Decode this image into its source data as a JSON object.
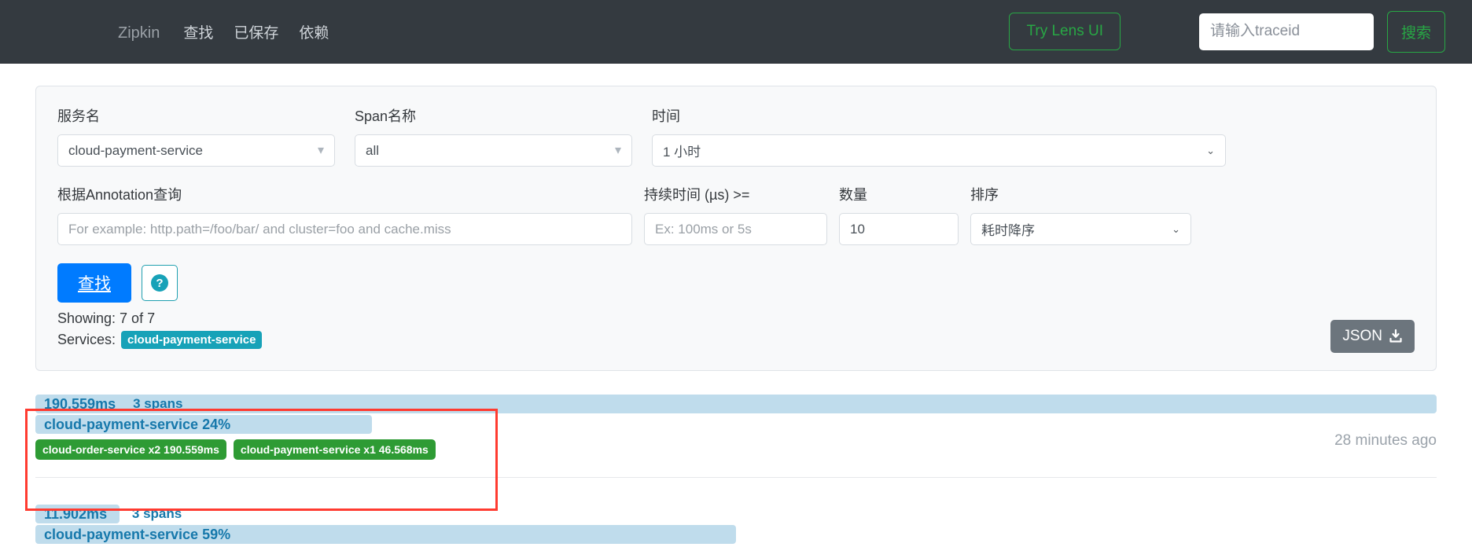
{
  "navbar": {
    "brand": "Zipkin",
    "items": [
      {
        "label": "查找",
        "name": "nav-find"
      },
      {
        "label": "已保存",
        "name": "nav-saved"
      },
      {
        "label": "依赖",
        "name": "nav-dependencies"
      }
    ],
    "lens_button": "Try Lens UI",
    "trace_search_placeholder": "请输入traceid",
    "trace_search_value": "",
    "search_button": "搜索",
    "accent_green": "#28a745",
    "background": "#343a40"
  },
  "search_panel": {
    "service": {
      "label": "服务名",
      "value": "cloud-payment-service"
    },
    "span": {
      "label": "Span名称",
      "value": "all"
    },
    "time": {
      "label": "时间",
      "value": "1 小时"
    },
    "annotation": {
      "label": "根据Annotation查询",
      "placeholder": "For example: http.path=/foo/bar/ and cluster=foo and cache.miss",
      "value": ""
    },
    "duration": {
      "label": "持续时间 (µs) >=",
      "placeholder": "Ex: 100ms or 5s",
      "value": ""
    },
    "limit": {
      "label": "数量",
      "value": "10"
    },
    "sort": {
      "label": "排序",
      "value": "耗时降序"
    },
    "find_button": "查找",
    "help_glyph": "?",
    "showing": "Showing: 7 of 7",
    "services_label": "Services:",
    "services_badges": [
      "cloud-payment-service"
    ],
    "json_button": "JSON",
    "primary_color": "#007bff",
    "badge_color": "#17a2b8"
  },
  "results": {
    "traces": [
      {
        "duration": "190.559ms",
        "spans": "3 spans",
        "root_service": "cloud-payment-service 24%",
        "duration_bar_pct": 100,
        "service_bar_pct": 24,
        "chips": [
          "cloud-order-service x2 190.559ms",
          "cloud-payment-service x1 46.568ms"
        ],
        "ago": "28 minutes ago",
        "highlighted": true
      },
      {
        "duration": "11.902ms",
        "spans": "3 spans",
        "root_service": "cloud-payment-service 59%",
        "duration_bar_pct": 6,
        "service_bar_pct": 59,
        "chips": [],
        "ago": "",
        "highlighted": false
      }
    ],
    "bar_color": "#bfdcec",
    "bar_text_color": "#1678ab",
    "chip_color": "#2e9b34",
    "highlight_color": "#ff3b30"
  }
}
